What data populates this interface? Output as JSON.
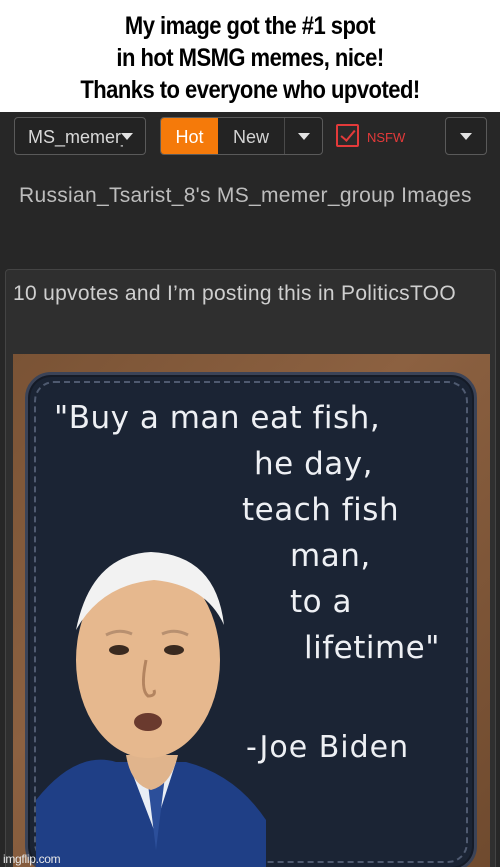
{
  "caption": {
    "line1": "My image got the #1 spot",
    "line2": "in hot MSMG memes, nice!",
    "line3": "Thanks to everyone who upvoted!"
  },
  "toolbar": {
    "group_select_value": "MS_memer_group",
    "sort_hot": "Hot",
    "sort_new": "New",
    "nsfw_label": "NSFW",
    "nsfw_checked": true,
    "accent_color": "#f57a0a",
    "nsfw_color": "#e33a3a"
  },
  "page": {
    "heading": "Russian_Tsarist_8's MS_memer_group Images"
  },
  "post": {
    "title": "10 upvotes and I’m posting this in PoliticsTOO",
    "image": {
      "quote_lines": [
        "\"Buy a man eat fish,",
        "he day,",
        "teach fish",
        "man,",
        "to a",
        "lifetime\""
      ],
      "attribution": "-Joe Biden"
    }
  },
  "watermark": "imgflip.com"
}
